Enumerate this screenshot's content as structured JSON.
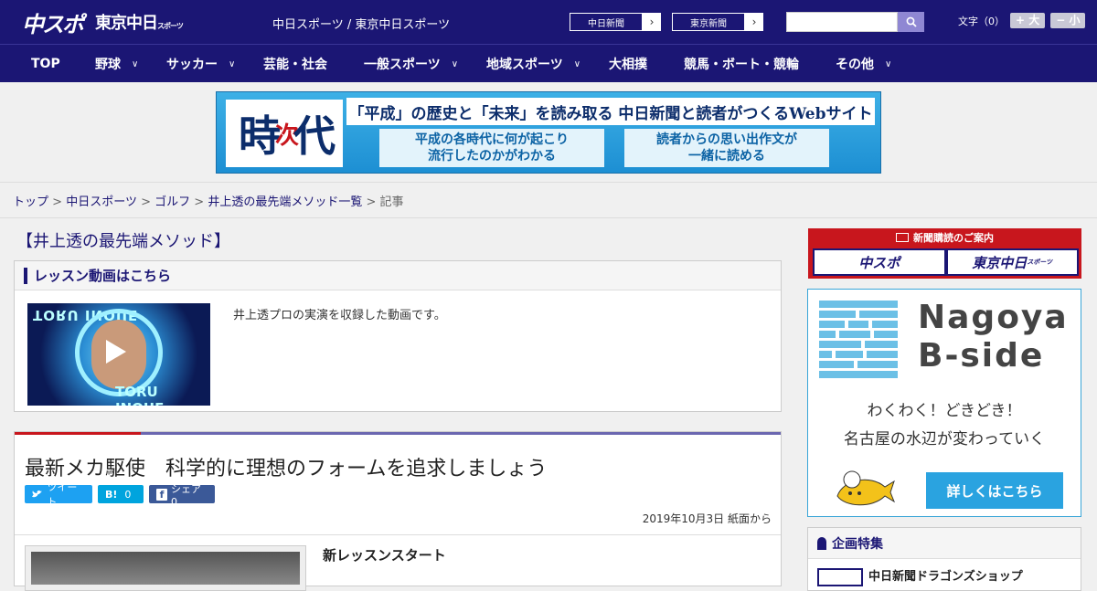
{
  "header": {
    "logo_chuspo": "中スポ",
    "logo_tokyo": "東京中日",
    "logo_tokyo_small": "スポーツ",
    "site_names": "中日スポーツ / 東京中日スポーツ",
    "paper_buttons": [
      {
        "label": "中日新聞",
        "arrow": "›"
      },
      {
        "label": "東京新聞",
        "arrow": "›"
      }
    ],
    "search": {
      "placeholder": "",
      "icon": "search-icon"
    },
    "font_size": {
      "label": "文字（0）",
      "larger": "+ 大",
      "smaller": "− 小"
    }
  },
  "nav": {
    "items": [
      {
        "label": "TOP",
        "chevron": ""
      },
      {
        "label": "野球",
        "chevron": "∨"
      },
      {
        "label": "サッカー",
        "chevron": "∨"
      },
      {
        "label": "芸能・社会",
        "chevron": ""
      },
      {
        "label": "一般スポーツ",
        "chevron": "∨"
      },
      {
        "label": "地域スポーツ",
        "chevron": "∨"
      },
      {
        "label": "大相撲",
        "chevron": ""
      },
      {
        "label": "競馬・ボート・競輪",
        "chevron": ""
      },
      {
        "label": "その他",
        "chevron": "∨"
      }
    ]
  },
  "banner": {
    "kanji_1": "時",
    "kanji_2": "次",
    "kanji_3": "代",
    "headline": "「平成」の歴史と「未来」を読み取る 中日新聞と読者がつくるWebサイト",
    "sub_left_1": "平成の各時代に何が起こり",
    "sub_left_2": "流行したのかがわかる",
    "sub_right_1": "読者からの思い出作文が",
    "sub_right_2": "一緒に読める"
  },
  "breadcrumb": {
    "items": [
      "トップ",
      "中日スポーツ",
      "ゴルフ",
      "井上透の最先端メソッド一覧"
    ],
    "separator": ">",
    "current": "記事"
  },
  "main": {
    "section_title": "【井上透の最先端メソッド】",
    "lesson": {
      "heading": "レッスン動画はこちら",
      "thumb_text_top": "TORU INOUE",
      "thumb_text_bottom": "TORU INOUE",
      "description": "井上透プロの実演を収録した動画です。"
    },
    "article": {
      "title": "最新メカ駆使　科学的に理想のフォームを追求しましょう",
      "share": [
        {
          "label": "ツイート",
          "icon": "twitter-icon",
          "color": "#1da1f2"
        },
        {
          "label": "0",
          "icon": "hatena-bookmark-icon",
          "icon_text": "B!",
          "color": "#00a4de"
        },
        {
          "label": "シェア 0",
          "icon": "facebook-icon",
          "icon_text": "f",
          "color": "#3b5998"
        }
      ],
      "date": "2019年10月3日 紙面から",
      "subheading": "新レッスンスタート"
    }
  },
  "sidebar": {
    "subscribe": {
      "caption": "新聞購読のご案内",
      "logo_left": "中スポ",
      "logo_right": "東京中日",
      "logo_right_small": "スポーツ"
    },
    "bside": {
      "title_1": "Nagoya",
      "title_2": "B-side",
      "message_1": "わくわく！どきどき！",
      "message_2": "名古屋の水辺が変わっていく",
      "button": "詳しくはこちら"
    },
    "special": {
      "heading": "企画特集",
      "item": "中日新聞ドラゴンズショップ"
    }
  },
  "colors": {
    "brand_navy": "#1b1674",
    "accent_red": "#c8161d",
    "bside_blue": "#2aa3e0"
  }
}
